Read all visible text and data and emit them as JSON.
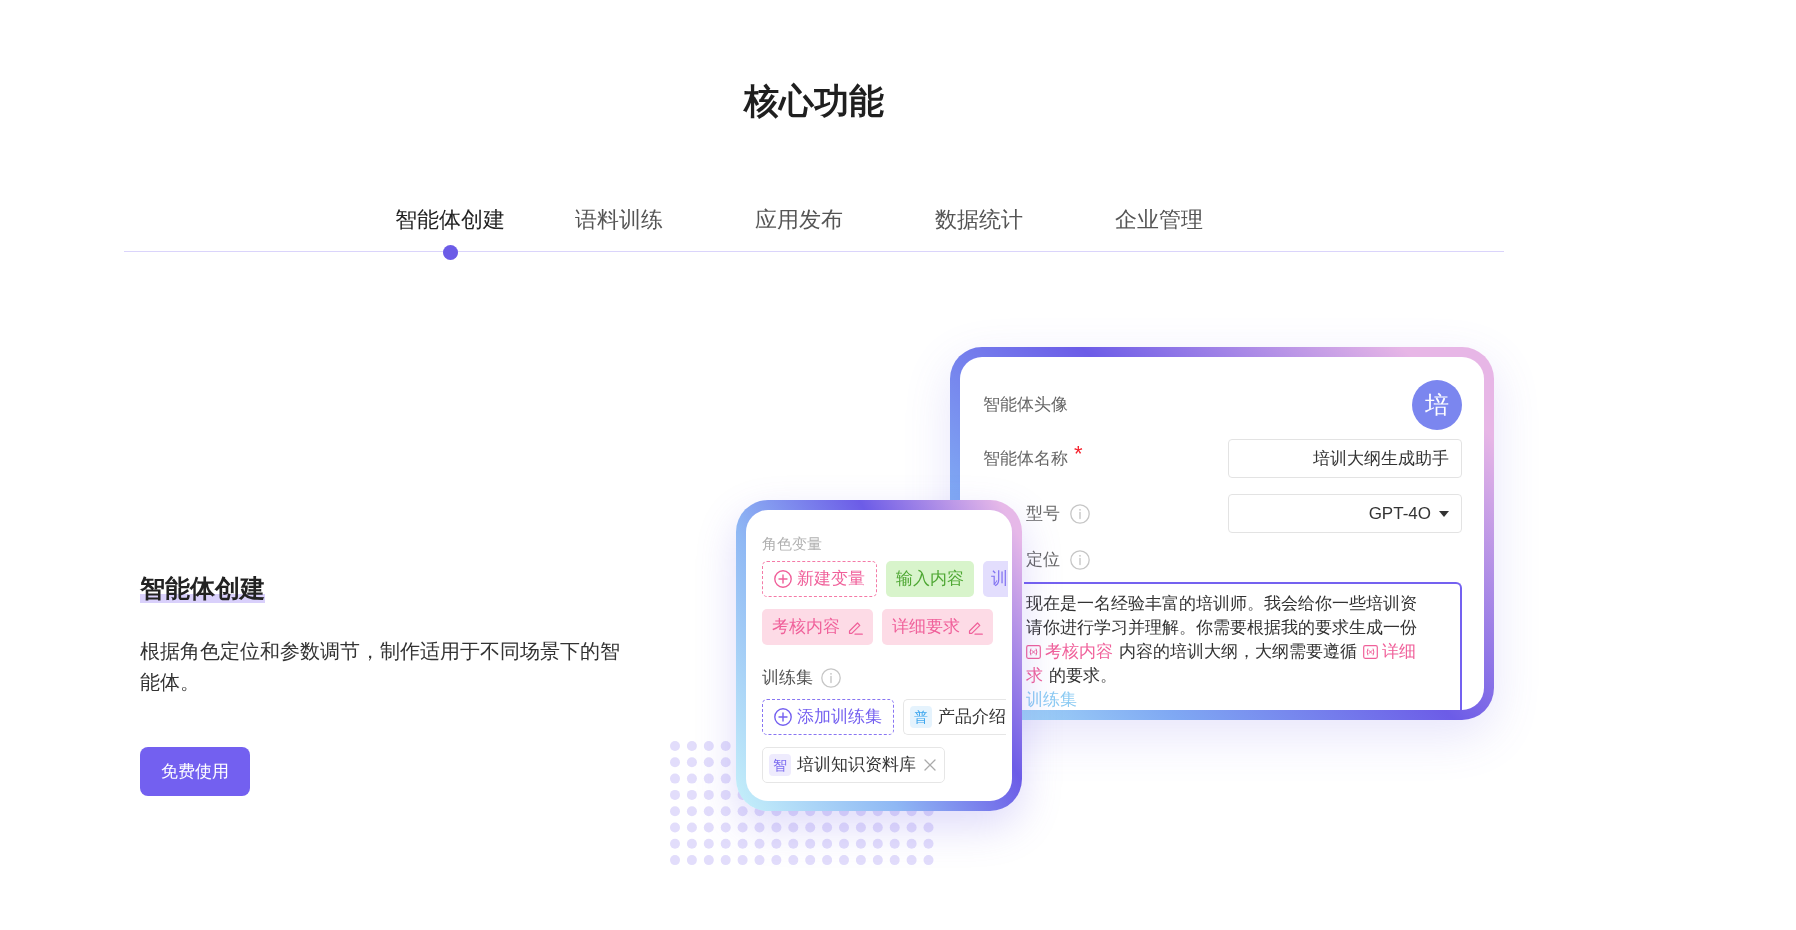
{
  "heading": {
    "title": "核心功能"
  },
  "tabs": [
    {
      "label": "智能体创建",
      "selected": true
    },
    {
      "label": "语料训练",
      "selected": false
    },
    {
      "label": "应用发布",
      "selected": false
    },
    {
      "label": "数据统计",
      "selected": false
    },
    {
      "label": "企业管理",
      "selected": false
    }
  ],
  "feature": {
    "title": "智能体创建",
    "description": "根据角色定位和参数调节，制作适用于不同场景下的智能体。",
    "button": "免费使用"
  },
  "agent_form": {
    "fields": [
      {
        "kind": "avatar",
        "label": "智能体头像",
        "info": false,
        "value": "培"
      },
      {
        "kind": "text",
        "label": "智能体名称",
        "info": false,
        "required_mark": "*",
        "value": "培训大纲生成助手"
      },
      {
        "kind": "select",
        "label": "型号",
        "info": true,
        "value": "GPT-4O"
      },
      {
        "kind": "textarea",
        "label": "定位",
        "info": true,
        "lines": [
          {
            "segments": [
              {
                "kind": "text",
                "text": "现在是一名经验丰富的培训师。我会给你一些培训资"
              }
            ]
          },
          {
            "segments": [
              {
                "kind": "text",
                "text": "请你进行学习并理解。你需要根据我的要求生成一份"
              }
            ]
          },
          {
            "segments": [
              {
                "kind": "variable",
                "text": "考核内容"
              },
              {
                "kind": "text",
                "text": "内容的培训大纲，大纲需要遵循"
              },
              {
                "kind": "variable",
                "text": "详细"
              }
            ]
          },
          {
            "segments": [
              {
                "kind": "variable_text",
                "text": "求"
              },
              {
                "kind": "text",
                "text": "的要求。"
              }
            ]
          }
        ],
        "footer_text": "训练集"
      }
    ]
  },
  "variable_card": {
    "variables_label": "角色变量",
    "variables": [
      {
        "kind": "new_variable",
        "text": "新建变量"
      },
      {
        "kind": "input_variable",
        "text": "输入内容"
      },
      {
        "kind": "training_variable",
        "text": "训"
      },
      {
        "kind": "variable",
        "text": "考核内容"
      },
      {
        "kind": "variable",
        "text": "详细要求"
      }
    ],
    "training_label": "训练集",
    "training_info": true,
    "training_sets": [
      {
        "kind": "add_set",
        "text": "添加训练集"
      },
      {
        "kind": "set",
        "badge": "普",
        "color": "#3ea6ee",
        "text": "产品介绍",
        "removable": false
      },
      {
        "kind": "set",
        "badge": "智",
        "color": "#7c6cf0",
        "text": "培训知识资料库",
        "removable": true
      }
    ]
  }
}
